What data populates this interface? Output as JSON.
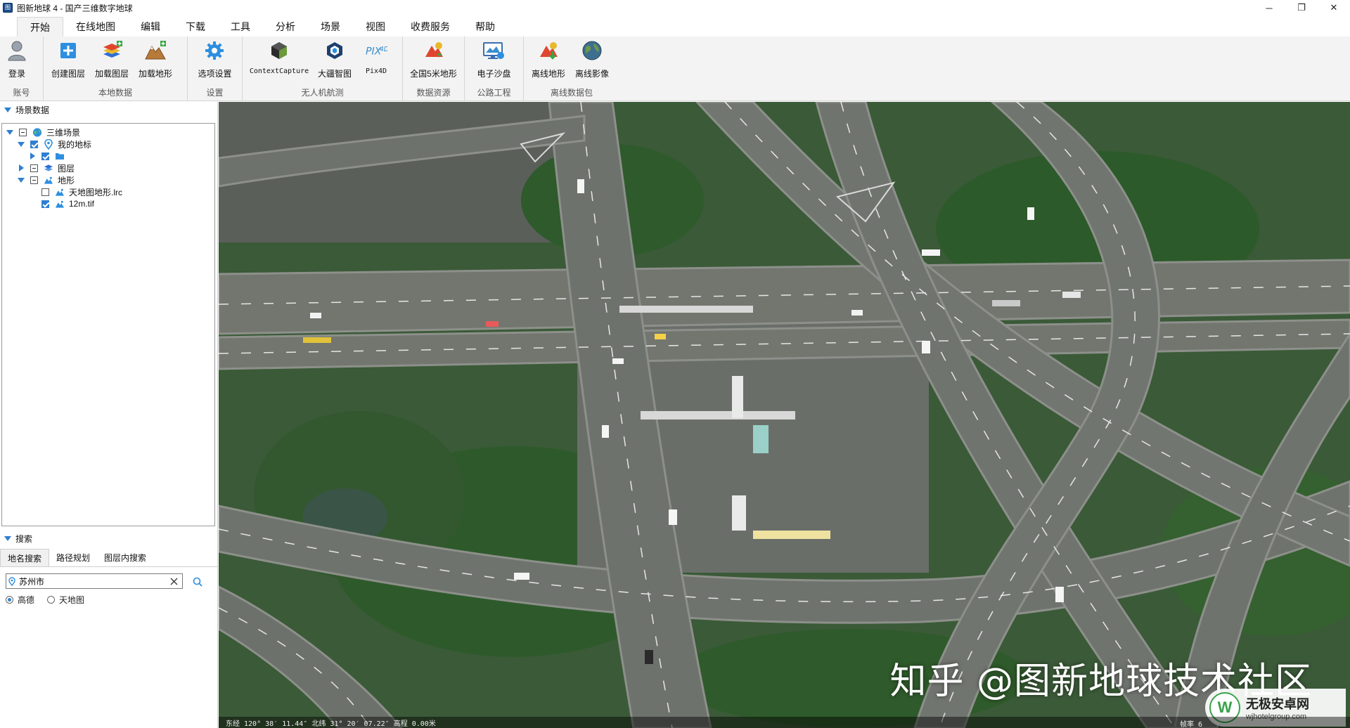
{
  "window": {
    "title": "图新地球 4 - 国产三维数字地球",
    "app_icon_text": "图",
    "controls": {
      "minimize": "─",
      "restore": "❐",
      "close": "✕"
    }
  },
  "menu": {
    "tabs": [
      "开始",
      "在线地图",
      "编辑",
      "下载",
      "工具",
      "分析",
      "场景",
      "视图",
      "收费服务",
      "帮助"
    ],
    "active": "开始"
  },
  "ribbon": {
    "groups": [
      {
        "label": "账号",
        "buttons": [
          {
            "label": "登录",
            "icon": "user-icon"
          }
        ]
      },
      {
        "label": "本地数据",
        "buttons": [
          {
            "label": "创建图层",
            "icon": "create-layer-icon"
          },
          {
            "label": "加载图层",
            "icon": "load-layer-icon"
          },
          {
            "label": "加载地形",
            "icon": "load-terrain-icon"
          }
        ]
      },
      {
        "label": "设置",
        "buttons": [
          {
            "label": "选项设置",
            "icon": "gear-icon"
          }
        ]
      },
      {
        "label": "无人机航测",
        "buttons": [
          {
            "label": "ContextCapture",
            "icon": "contextcapture-icon"
          },
          {
            "label": "大疆智图",
            "icon": "dji-terra-icon"
          },
          {
            "label": "Pix4D",
            "icon": "pix4d-icon"
          }
        ]
      },
      {
        "label": "数据资源",
        "buttons": [
          {
            "label": "全国5米地形",
            "icon": "terrain-5m-icon"
          }
        ]
      },
      {
        "label": "公路工程",
        "buttons": [
          {
            "label": "电子沙盘",
            "icon": "sand-table-icon"
          }
        ]
      },
      {
        "label": "离线数据包",
        "buttons": [
          {
            "label": "离线地形",
            "icon": "offline-terrain-icon"
          },
          {
            "label": "离线影像",
            "icon": "offline-imagery-icon"
          }
        ]
      }
    ]
  },
  "scene_panel": {
    "title": "场景数据",
    "tree": [
      {
        "label": "三维场景",
        "level": 0,
        "expanded": true,
        "check": "partial",
        "icon": "globe-icon"
      },
      {
        "label": "我的地标",
        "level": 1,
        "expanded": true,
        "check": "checked",
        "icon": "pin-icon"
      },
      {
        "label": "",
        "level": 2,
        "expanded": false,
        "check": "checked",
        "icon": "folder-icon"
      },
      {
        "label": "图层",
        "level": 1,
        "expanded": false,
        "check": "partial",
        "icon": "layers-icon"
      },
      {
        "label": "地形",
        "level": 1,
        "expanded": true,
        "check": "partial",
        "icon": "terrain-icon"
      },
      {
        "label": "天地图地形.lrc",
        "level": 2,
        "expanded": null,
        "check": "unchecked",
        "icon": "terrain-file-icon"
      },
      {
        "label": "12m.tif",
        "level": 2,
        "expanded": null,
        "check": "checked",
        "icon": "terrain-file-icon"
      }
    ]
  },
  "search_panel": {
    "title": "搜索",
    "tabs": [
      "地名搜索",
      "路径规划",
      "图层内搜索"
    ],
    "active_tab": "地名搜索",
    "input_value": "苏州市",
    "sources": [
      {
        "label": "高德",
        "selected": true
      },
      {
        "label": "天地图",
        "selected": false
      }
    ]
  },
  "map": {
    "watermark": "知乎 @图新地球技术社区",
    "status": "东经 120° 38′ 11.44″ 北纬 31° 20′ 07.22″ 高程 0.00米",
    "status_right": "帧率 6",
    "site_logo": {
      "mark": "W",
      "name": "无极安卓网",
      "url": "wjhotelgroup.com"
    },
    "colors": {
      "road": "#6f7370",
      "road_edge": "#8a8c88",
      "vegetation": "#355a34",
      "lane_mark": "#e8e8e8"
    }
  }
}
